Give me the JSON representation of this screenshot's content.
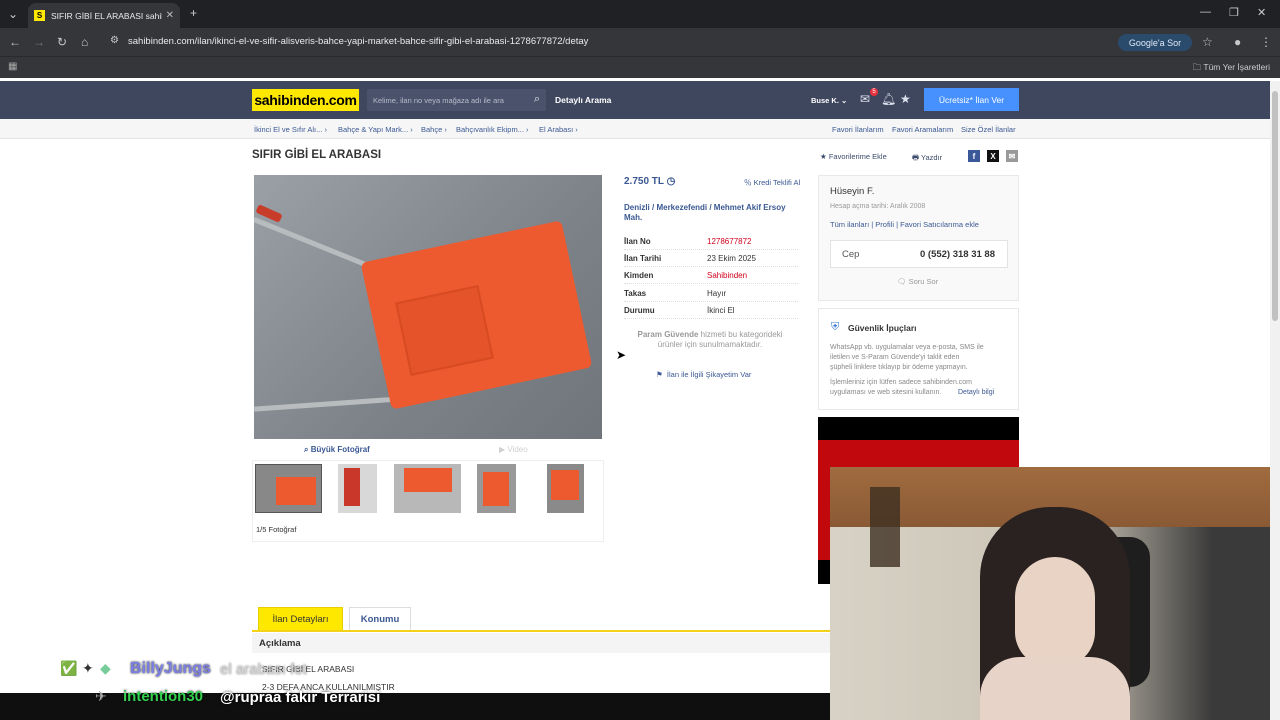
{
  "browser": {
    "tab_title": "SIFIR GİBİ EL ARABASI sahibinden",
    "url": "sahibinden.com/ilan/ikinci-el-ve-sifir-alisveris-bahce-yapi-market-bahce-sifir-gibi-el-arabasi-1278677872/detay",
    "google_sor": "Google'a Sor",
    "bookmarks_all": "Tüm Yer İşaretleri"
  },
  "header": {
    "logo": "sahibinden.com",
    "search_placeholder": "Kelime, ilan no veya mağaza adı ile ara",
    "detailed_search": "Detaylı Arama",
    "user": "Buse K.",
    "notif_count": "5",
    "post_button": "Ücretsiz* İlan Ver"
  },
  "breadcrumbs": [
    "İkinci El ve Sıfır Alı...",
    "Bahçe & Yapı Mark...",
    "Bahçe",
    "Bahçıvanlık Ekipm...",
    "El Arabası"
  ],
  "top_links": [
    "Favori İlanlarım",
    "Favori Aramalarım",
    "Size Özel İlanlar"
  ],
  "listing": {
    "title": "SIFIR GİBİ EL ARABASI",
    "add_favorite": "Favorilerime Ekle",
    "print": "Yazdır",
    "big_photo": "Büyük Fotoğraf",
    "video": "Video",
    "photo_count": "1/5 Fotoğraf",
    "price": "2.750 TL",
    "credit": "Kredi Teklifi Al",
    "location": "Denizli  /  Merkezefendi  /  Mehmet Akif Ersoy Mah.",
    "details": [
      {
        "k": "İlan No",
        "v": "1278677872"
      },
      {
        "k": "İlan Tarihi",
        "v": "23 Ekim 2025"
      },
      {
        "k": "Kimden",
        "v": "Sahibinden"
      },
      {
        "k": "Takas",
        "v": "Hayır"
      },
      {
        "k": "Durumu",
        "v": "İkinci El"
      }
    ],
    "param_bold": "Param Güvende",
    "param_rest": " hizmeti bu kategorideki ürünler için sunulmamaktadır.",
    "complaint": "İlan ile İlgili Şikayetim Var"
  },
  "seller": {
    "name": "Hüseyin F.",
    "since": "Hesap açma tarihi: Aralık 2008",
    "links": "Tüm ilanları  |  Profili  |  Favori Satıcılarıma ekle",
    "phone_label": "Cep",
    "phone": "0 (552) 318 31 88",
    "ask": "Soru Sor"
  },
  "security": {
    "title": "Güvenlik İpuçları",
    "line1": "WhatsApp vb. uygulamalar veya e-posta, SMS ile",
    "line2": "iletilen ve S-Param Güvende'yi taklit eden",
    "line3": "şüpheli linklere tıklayıp bir ödeme yapmayın.",
    "line4": "İşlemleriniz için lütfen sadece sahibinden.com",
    "line5": "uygulaması ve web sitesini kullanın.",
    "more": "Detaylı bilgi"
  },
  "tabs": {
    "details": "İlan Detayları",
    "location": "Konumu"
  },
  "description": {
    "heading": "Açıklama",
    "line1": "SIFIR GİBİ EL ARABASI",
    "line2": "2-3 DEFA ANCA KULLANILMIŞTIR"
  },
  "chat": {
    "user1": "BillyJungs",
    "msg1": "el arabası fet",
    "user2": "intention30",
    "msg2": "@rupraa fakir Terrarisi"
  },
  "colors": {
    "brand_yellow": "#ffe800",
    "header": "#3f475f",
    "link": "#3a5893",
    "red": "#d0021b"
  }
}
